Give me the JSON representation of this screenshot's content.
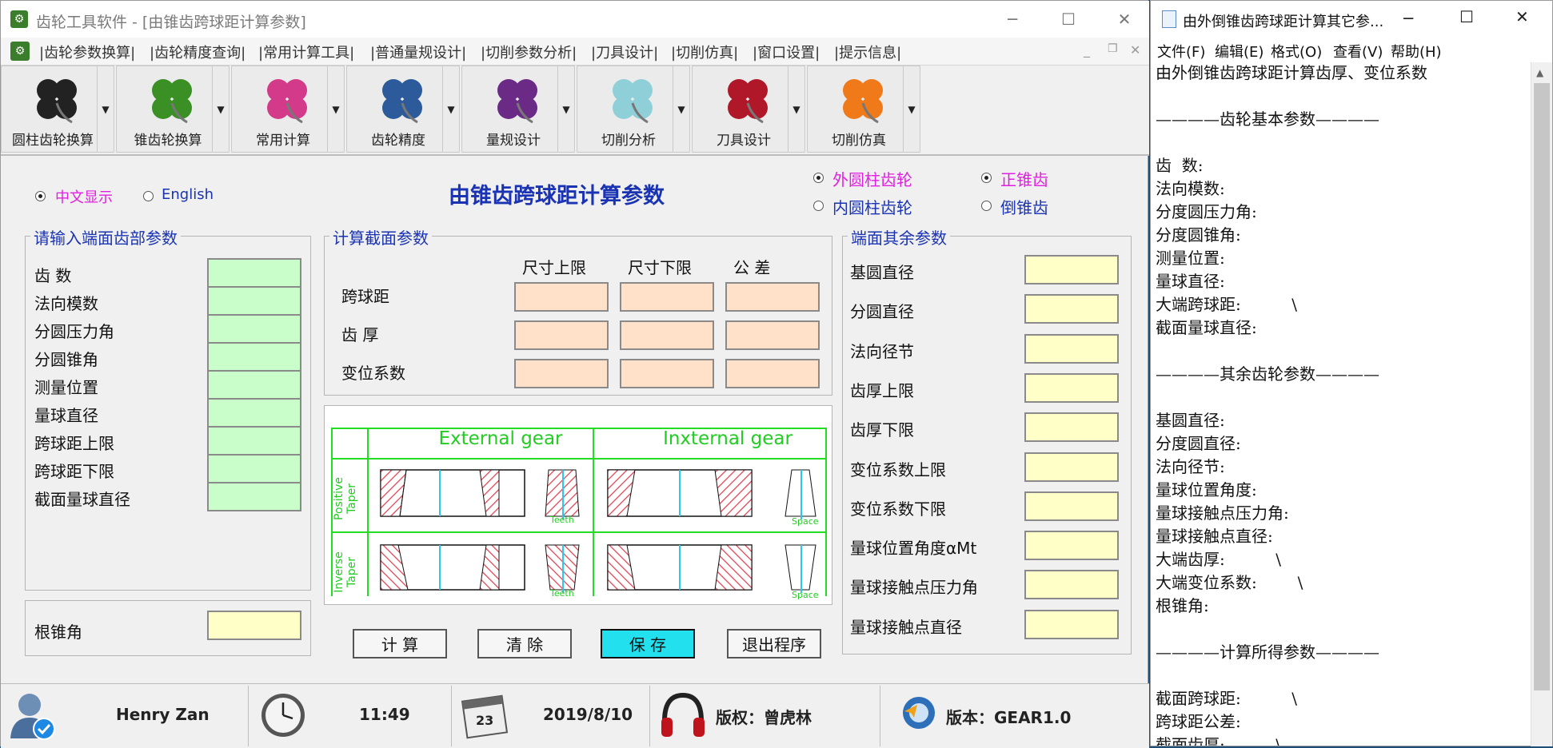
{
  "main": {
    "title": "齿轮工具软件 - [由锥齿跨球距计算参数]",
    "menu": [
      "|齿轮参数换算|",
      "|齿轮精度查询|",
      "|常用计算工具|",
      "|普通量规设计|",
      "|切削参数分析|",
      "|刀具设计|",
      "|切削仿真|",
      "|窗口设置|",
      "|提示信息|"
    ],
    "toolbar": [
      {
        "label": "圆柱齿轮换算",
        "icon": "black-clover-icon",
        "color": "#222222"
      },
      {
        "label": "锥齿轮换算",
        "icon": "green-clover-icon",
        "color": "#3a8f25"
      },
      {
        "label": "常用计算",
        "icon": "colorful-clover-icon",
        "color": "#d43a8a"
      },
      {
        "label": "齿轮精度",
        "icon": "blue-clover-icon",
        "color": "#2c5a9a"
      },
      {
        "label": "量规设计",
        "icon": "purple-clover-icon",
        "color": "#6a2a86"
      },
      {
        "label": "切削分析",
        "icon": "lightblue-clover-icon",
        "color": "#8fd0d8"
      },
      {
        "label": "刀具设计",
        "icon": "red-clover-icon",
        "color": "#b0182a"
      },
      {
        "label": "切削仿真",
        "icon": "orange-clover-icon",
        "color": "#f07a1a"
      }
    ],
    "lang": {
      "cn": "中文显示",
      "en": "English"
    },
    "page_title": "由锥齿跨球距计算参数",
    "gear_type": {
      "external": "外圆柱齿轮",
      "internal": "内圆柱齿轮"
    },
    "taper_type": {
      "positive": "正锥齿",
      "inverse": "倒锥齿"
    },
    "input_group": {
      "title": "请输入端面齿部参数",
      "fields": [
        "齿 数",
        "法向模数",
        "分圆压力角",
        "分圆锥角",
        "测量位置",
        "量球直径",
        "跨球距上限",
        "跨球距下限",
        "截面量球直径"
      ]
    },
    "root_cone": {
      "label": "根锥角"
    },
    "section_group": {
      "title": "计算截面参数",
      "headers": [
        "尺寸上限",
        "尺寸下限",
        "公 差"
      ],
      "rows": [
        "跨球距",
        "齿 厚",
        "变位系数"
      ]
    },
    "diagram": {
      "external": "External gear",
      "internal": "Inxternal gear",
      "positive": "Positive Taper",
      "inverse": "Inverse Taper",
      "teeth": "Teeth",
      "space": "Space"
    },
    "other_group": {
      "title": "端面其余参数",
      "fields": [
        "基圆直径",
        "分圆直径",
        "法向径节",
        "齿厚上限",
        "齿厚下限",
        "变位系数上限",
        "变位系数下限",
        "量球位置角度αMt",
        "量球接触点压力角",
        "量球接触点直径"
      ]
    },
    "buttons": {
      "calc": "计 算",
      "clear": "清 除",
      "save": "保 存",
      "exit": "退出程序"
    },
    "status": {
      "user": "Henry Zan",
      "time": "11:49",
      "date": "2019/8/10",
      "copyright": "版权：曾虎林",
      "version": "版本：GEAR1.0",
      "calendar_day": "23"
    }
  },
  "notepad": {
    "title": "由外倒锥齿跨球距计算其它参...",
    "menu": [
      "文件(F)",
      "编辑(E)",
      "格式(O)",
      "查看(V)",
      "帮助(H)"
    ],
    "lines": [
      "由外倒锥齿跨球距计算齿厚、变位系数",
      "",
      "————齿轮基本参数————",
      "",
      "齿  数:",
      "法向模数:",
      "分度圆压力角:",
      "分度圆锥角:",
      "测量位置:",
      "量球直径:",
      "大端跨球距:          \\",
      "截面量球直径:",
      "",
      "————其余齿轮参数————",
      "",
      "基圆直径:",
      "分度圆直径:",
      "法向径节:",
      "量球位置角度:",
      "量球接触点压力角:",
      "量球接触点直径:",
      "大端齿厚:          \\",
      "大端变位系数:        \\",
      "根锥角:",
      "",
      "————计算所得参数————",
      "",
      "截面跨球距:          \\",
      "跨球距公差:",
      "截面齿厚:          \\"
    ]
  }
}
